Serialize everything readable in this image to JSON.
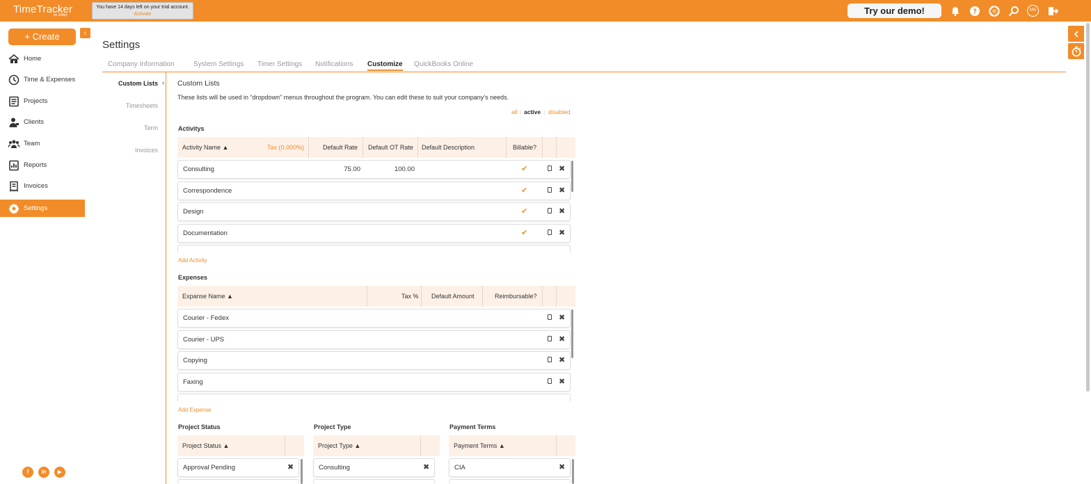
{
  "app": {
    "brand": "TimeTracker",
    "brand_sub": "by eBility"
  },
  "trial": {
    "text": "You have 14 days left on your trial account.",
    "link": "Activate"
  },
  "header": {
    "demo_label": "Try our demo!",
    "avatar_initials": "MS",
    "icons": [
      "bell-icon",
      "help-icon",
      "support-icon",
      "search-icon",
      "logout-icon"
    ]
  },
  "sidebar": {
    "create_label": "+ Create",
    "items": [
      {
        "label": "Home",
        "icon": "home-icon"
      },
      {
        "label": "Time & Expenses",
        "icon": "clock-icon"
      },
      {
        "label": "Projects",
        "icon": "projects-icon"
      },
      {
        "label": "Clients",
        "icon": "clients-icon"
      },
      {
        "label": "Team",
        "icon": "team-icon"
      },
      {
        "label": "Reports",
        "icon": "reports-icon"
      },
      {
        "label": "Invoices",
        "icon": "invoices-icon"
      },
      {
        "label": "Settings",
        "icon": "gear-icon",
        "active": true
      }
    ],
    "social": [
      "f",
      "in",
      "▶"
    ]
  },
  "page": {
    "title": "Settings",
    "tabs": [
      "Company Information",
      "System Settings",
      "Timer Settings",
      "Notifications",
      "Customize",
      "QuickBooks Online"
    ],
    "active_tab": "Customize"
  },
  "subnav": {
    "items": [
      "Custom Lists",
      "Timesheets",
      "Term",
      "Invoices"
    ],
    "active": "Custom Lists"
  },
  "custom_lists": {
    "title": "Custom Lists",
    "description": "These lists will be used in “dropdown” menus throughout the program. You can edit these to suit your company’s needs.",
    "filters": {
      "all": "all",
      "active": "active",
      "disabled": "disabled",
      "selected": "active"
    }
  },
  "activities": {
    "title": "Activitys",
    "headers": {
      "name": "Activity Name ▲",
      "tax": "Tax (0.000%)",
      "rate": "Default Rate",
      "ot_rate": "Default OT Rate",
      "description": "Default Description",
      "billable": "Billable?"
    },
    "rows": [
      {
        "name": "Consulting",
        "rate": "75.00",
        "ot_rate": "100.00",
        "billable": "✔"
      },
      {
        "name": "Correspondence",
        "rate": "",
        "ot_rate": "",
        "billable": "✔"
      },
      {
        "name": "Design",
        "rate": "",
        "ot_rate": "",
        "billable": "✔"
      },
      {
        "name": "Documentation",
        "rate": "",
        "ot_rate": "",
        "billable": "✔"
      }
    ],
    "add_label": "Add Activity"
  },
  "expenses": {
    "title": "Expenses",
    "headers": {
      "name": "Expanse Name ▲",
      "tax": "Tax %",
      "amount": "Default Amount",
      "reimbursable": "Reimbursable?"
    },
    "rows": [
      {
        "name": "Courier - Fedex"
      },
      {
        "name": "Courier - UPS"
      },
      {
        "name": "Copying"
      },
      {
        "name": "Faxing"
      }
    ],
    "add_label": "Add Expense"
  },
  "project_status": {
    "title": "Project Status",
    "header": "Project Status ▲",
    "rows": [
      "Approval Pending"
    ]
  },
  "project_type": {
    "title": "Project Type",
    "header": "Project Type ▲",
    "rows": [
      "Consulting"
    ]
  },
  "payment_terms": {
    "title": "Payment Terms",
    "header": "Payment Terms ▲",
    "rows": [
      "CIA"
    ]
  },
  "colors": {
    "accent": "#f28c28",
    "header_bg": "#fdf1e7"
  }
}
